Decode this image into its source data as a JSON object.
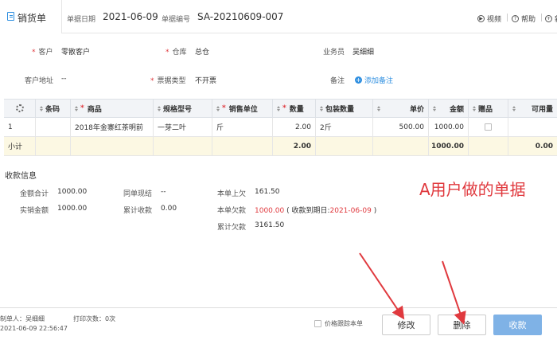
{
  "header": {
    "tab_label": "销货单",
    "date_label": "单据日期",
    "date_value": "2021-06-09",
    "number_label": "单据编号",
    "number_value": "SA-20210609-007",
    "video_label": "视频",
    "help_label": "帮助",
    "new_label": "新"
  },
  "form": {
    "customer_label": "客户",
    "customer_value": "零散客户",
    "warehouse_label": "仓库",
    "warehouse_value": "总仓",
    "salesman_label": "业务员",
    "salesman_value": "吴细细",
    "address_label": "客户地址",
    "address_value": "--",
    "invoice_label": "票据类型",
    "invoice_value": "不开票",
    "remark_label": "备注",
    "add_remark": "添加备注"
  },
  "table": {
    "headers": {
      "barcode": "条码",
      "product": "商品",
      "spec": "规格型号",
      "unit": "销售单位",
      "qty": "数量",
      "pack": "包装数量",
      "price": "单价",
      "amount": "金额",
      "gift": "赠品",
      "stock": "可用量"
    },
    "row1": {
      "index": "1",
      "product": "2018年金寨红茶明前",
      "spec": "一芽二叶",
      "unit": "斤",
      "qty": "2.00",
      "pack": "2斤",
      "price": "500.00",
      "amount": "1000.00"
    },
    "subtotal": {
      "label": "小计",
      "qty": "2.00",
      "amount": "1000.00",
      "stock": "0.00"
    }
  },
  "payment": {
    "title": "收款信息",
    "total_label": "金额合计",
    "total_value": "1000.00",
    "cash_label": "同单现结",
    "cash_value": "--",
    "prev_owed_label": "本单上欠",
    "prev_owed_value": "161.50",
    "actual_label": "实销金额",
    "actual_value": "1000.00",
    "received_label": "累计收款",
    "received_value": "0.00",
    "owed_label": "本单欠款",
    "owed_value": "1000.00",
    "due_prefix": "( 收款到期日:",
    "due_date": "2021-06-09",
    "due_suffix": ")",
    "total_owed_label": "累计欠款",
    "total_owed_value": "3161.50"
  },
  "annotation": "A用户做的单据",
  "footer": {
    "maker": "制单人：吴细细",
    "print_count": "打印次数：0次",
    "created_time": "2021-06-09 22:56:47",
    "price_track_label": "价格跟踪本单",
    "edit_button": "修改",
    "delete_button": "删除",
    "collect_button": "收款"
  },
  "colors": {
    "accent": "#2f8fe0",
    "required": "#e0393e",
    "annotation": "#e0393e",
    "subtotal_bg": "#fcf8e3",
    "primary_button": "#7fb2e6"
  }
}
